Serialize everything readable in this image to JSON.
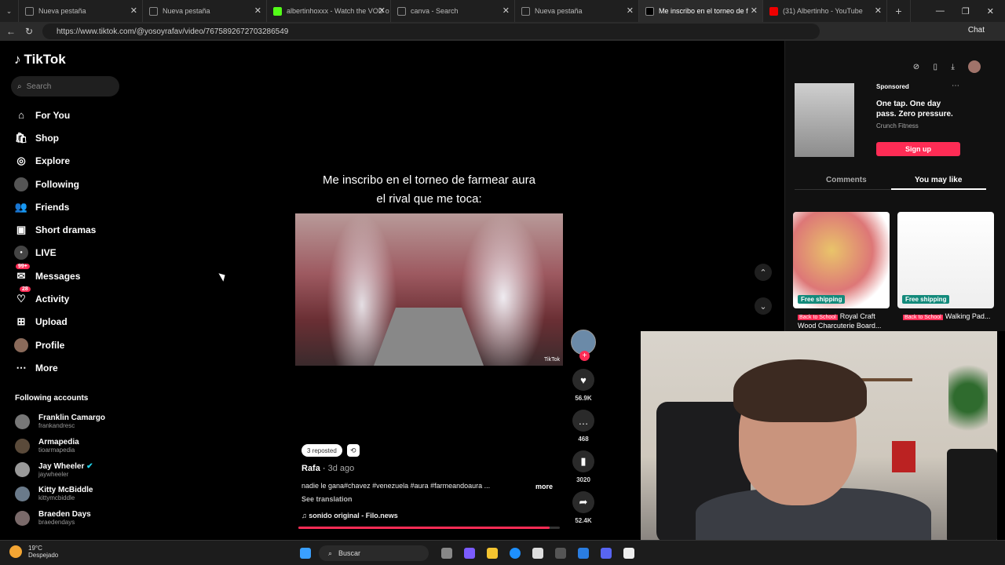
{
  "browser": {
    "tabs": [
      {
        "label": "Nueva pestaña"
      },
      {
        "label": "Nueva pestaña"
      },
      {
        "label": "albertinhoxxx - Watch the VOD o"
      },
      {
        "label": "canva - Search"
      },
      {
        "label": "Nueva pestaña"
      },
      {
        "label": "Me inscribo en el torneo de f"
      },
      {
        "label": "(31) Albertinho - YouTube"
      }
    ],
    "url": "https://www.tiktok.com/@yosoyrafav/video/7675892672703286549",
    "chat_label": "Chat"
  },
  "tiktok": {
    "logo": "TikTok",
    "search_placeholder": "Search",
    "nav": [
      {
        "label": "For You",
        "icon": "home-icon"
      },
      {
        "label": "Shop",
        "icon": "shop-icon"
      },
      {
        "label": "Explore",
        "icon": "compass-icon"
      },
      {
        "label": "Following",
        "icon": "following-icon"
      },
      {
        "label": "Friends",
        "icon": "friends-icon"
      },
      {
        "label": "Short dramas",
        "icon": "film-icon"
      },
      {
        "label": "LIVE",
        "icon": "live-icon"
      },
      {
        "label": "Messages",
        "icon": "message-icon",
        "badge": "99+"
      },
      {
        "label": "Activity",
        "icon": "activity-icon",
        "badge": "28"
      },
      {
        "label": "Upload",
        "icon": "upload-icon"
      },
      {
        "label": "Profile",
        "icon": "avatar-icon"
      },
      {
        "label": "More",
        "icon": "more-icon"
      }
    ],
    "following_title": "Following accounts",
    "following": [
      {
        "name": "Franklin Camargo",
        "handle": "frankandresc"
      },
      {
        "name": "Armapedia",
        "handle": "tioarmapedia"
      },
      {
        "name": "Jay Wheeler",
        "handle": "jaywheeler"
      },
      {
        "name": "Kitty McBiddle",
        "handle": "kittymcbiddle"
      },
      {
        "name": "Braeden Days",
        "handle": "braedendays"
      }
    ]
  },
  "video": {
    "caption_line1": "Me inscribo en el torneo de farmear aura",
    "caption_line2": "el rival que me toca:",
    "watermark": "TikTok",
    "likes": "56.9K",
    "comments": "468",
    "saves": "3020",
    "shares": "52.4K",
    "reposted": "3 reposted",
    "author": "Rafa",
    "age": "3d ago",
    "description": "nadie le gana#chavez #venezuela #aura #farmeandoaura ...",
    "more": "more",
    "see_translation": "See translation",
    "music": "sonido original - Filo.news",
    "progress": 0.96
  },
  "right_panel": {
    "sponsored": "Sponsored",
    "ad_text": "One tap. One day pass. Zero pressure.",
    "ad_brand": "Crunch Fitness",
    "signup": "Sign up",
    "tab_comments": "Comments",
    "tab_you_may_like": "You may like",
    "products": [
      {
        "badge": "Free shipping",
        "tag": "Back to School",
        "title": "Royal Craft Wood Charcuterie Board..."
      },
      {
        "badge": "Free shipping",
        "tag": "Back to School",
        "title": "Walking Pad..."
      }
    ]
  },
  "taskbar": {
    "temp": "19°C",
    "weather": "Despejado",
    "search": "Buscar"
  },
  "colors": {
    "accent": "#fe2c55",
    "ship_badge": "#138a7b"
  }
}
